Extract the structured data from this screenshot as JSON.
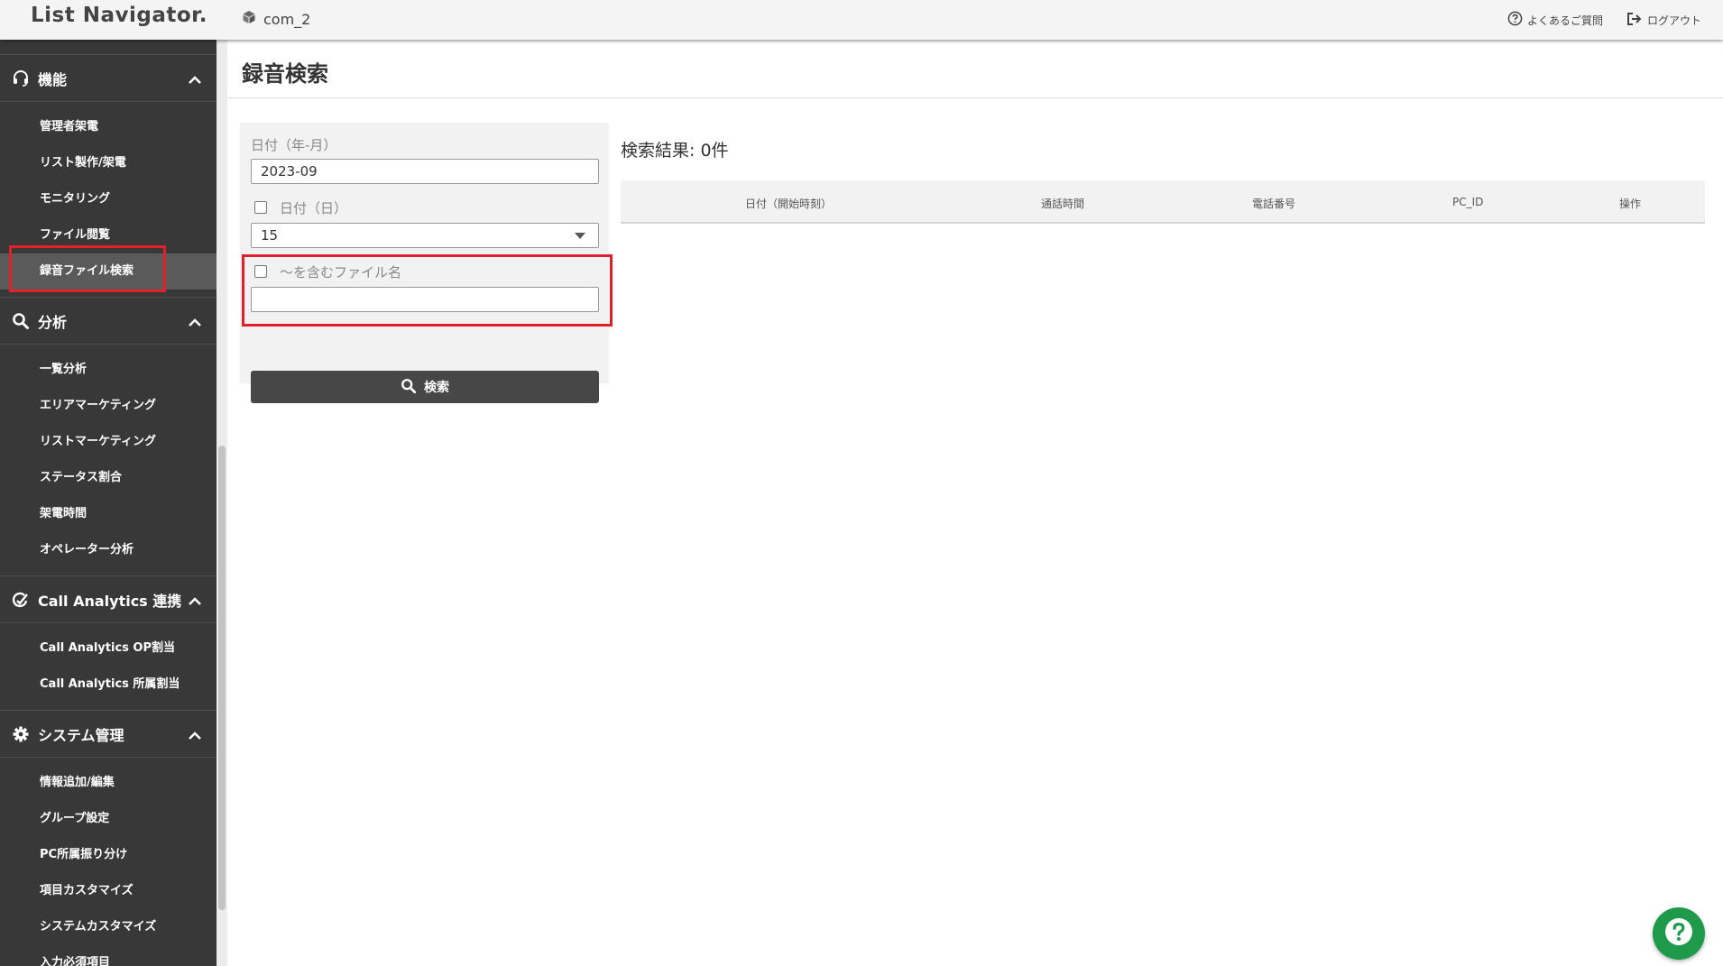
{
  "app": {
    "logo": "List Navigator.",
    "company": "com_2"
  },
  "header": {
    "faq_label": "よくあるご質問",
    "logout_label": "ログアウト"
  },
  "sidebar": {
    "sections": [
      {
        "title": "機能",
        "icon": "headset-icon",
        "items": [
          "管理者架電",
          "リスト製作/架電",
          "モニタリング",
          "ファイル閲覧",
          "録音ファイル検索"
        ]
      },
      {
        "title": "分析",
        "icon": "search-icon",
        "items": [
          "一覧分析",
          "エリアマーケティング",
          "リストマーケティング",
          "ステータス割合",
          "架電時間",
          "オペレーター分析"
        ]
      },
      {
        "title": "Call Analytics 連携",
        "icon": "analytics-icon",
        "items": [
          "Call Analytics OP割当",
          "Call Analytics 所属割当"
        ]
      },
      {
        "title": "システム管理",
        "icon": "gear-icon",
        "items": [
          "情報追加/編集",
          "グループ設定",
          "PC所属振り分け",
          "項目カスタマイズ",
          "システムカスタマイズ",
          "入力必須項目"
        ]
      }
    ],
    "active_item": "録音ファイル検索"
  },
  "page": {
    "title": "録音検索"
  },
  "search_form": {
    "month_label": "日付（年-月）",
    "month_value": "2023-09",
    "day_label": "日付（日）",
    "day_value": "15",
    "filename_label": "〜を含むファイル名",
    "filename_value": "",
    "search_button": "検索"
  },
  "results": {
    "title": "検索結果: 0件",
    "columns": [
      "日付（開始時刻）",
      "通話時間",
      "電話番号",
      "PC_ID",
      "操作"
    ]
  },
  "colors": {
    "sidebar_bg": "#383838",
    "highlight": "#e0202a",
    "help_fab": "#1f9a4a"
  }
}
